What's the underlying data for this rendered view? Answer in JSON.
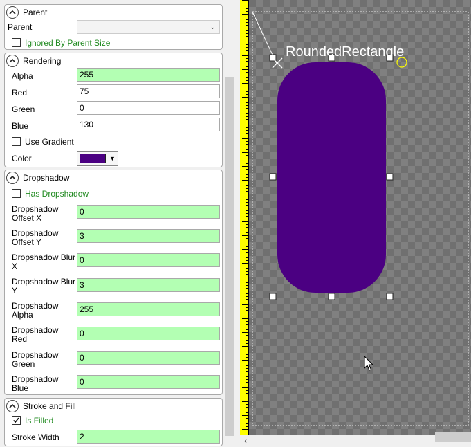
{
  "panel": {
    "parent": {
      "title": "Parent",
      "parent_label": "Parent",
      "parent_value": "",
      "ignored_label": "Ignored By Parent Size"
    },
    "rendering": {
      "title": "Rendering",
      "alpha_label": "Alpha",
      "alpha_value": "255",
      "red_label": "Red",
      "red_value": "75",
      "green_label": "Green",
      "green_value": "0",
      "blue_label": "Blue",
      "blue_value": "130",
      "gradient_label": "Use Gradient",
      "color_label": "Color",
      "color_value": "#4b0082"
    },
    "dropshadow": {
      "title": "Dropshadow",
      "has_label": "Has Dropshadow",
      "offset_x_label": [
        "Dropshadow",
        "Offset X"
      ],
      "offset_x_value": "0",
      "offset_y_label": [
        "Dropshadow",
        "Offset Y"
      ],
      "offset_y_value": "3",
      "blur_x_label": [
        "Dropshadow Blur",
        "X"
      ],
      "blur_x_value": "0",
      "blur_y_label": [
        "Dropshadow Blur",
        "Y"
      ],
      "blur_y_value": "3",
      "alpha_label": [
        "Dropshadow",
        "Alpha"
      ],
      "alpha_value": "255",
      "red_label": [
        "Dropshadow",
        "Red"
      ],
      "red_value": "0",
      "green_label": [
        "Dropshadow",
        "Green"
      ],
      "green_value": "0",
      "blue_label": [
        "Dropshadow",
        "Blue"
      ],
      "blue_value": "0"
    },
    "stroke": {
      "title": "Stroke and Fill",
      "filled_label": "Is Filled",
      "width_label": "Stroke Width",
      "width_value": "2"
    }
  },
  "canvas": {
    "object_name": "RoundedRectangle",
    "fill_color": "#4b0082"
  },
  "icons": {
    "collapse": "chevron-up-icon",
    "dropdown": "chevron-down-icon",
    "cursor": "mouse-cursor-icon",
    "scroll_left": "chevron-left-icon"
  }
}
